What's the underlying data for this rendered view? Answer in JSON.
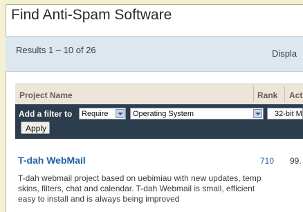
{
  "page": {
    "title": "Find Anti-Spam Software"
  },
  "results": {
    "summary": "Results 1 – 10 of 26",
    "display_label": "Displa"
  },
  "table_header": {
    "project_name": "Project Name",
    "rank": "Rank",
    "activity": "Act"
  },
  "filter": {
    "label": "Add a filter to",
    "mode_select": "Require",
    "field_select": "Operating System",
    "value_select": "32-bit M",
    "apply_label": "Apply"
  },
  "rows": [
    {
      "title": "T-dah WebMail",
      "rank": "710",
      "activity": "99.",
      "description_lines": [
        "T-dah webmail project based on uebimiau with new updates, temp",
        "skins, filters, chat and calendar. T-dah Webmail is small, efficient",
        "easy to install and is always being improved"
      ]
    }
  ]
}
